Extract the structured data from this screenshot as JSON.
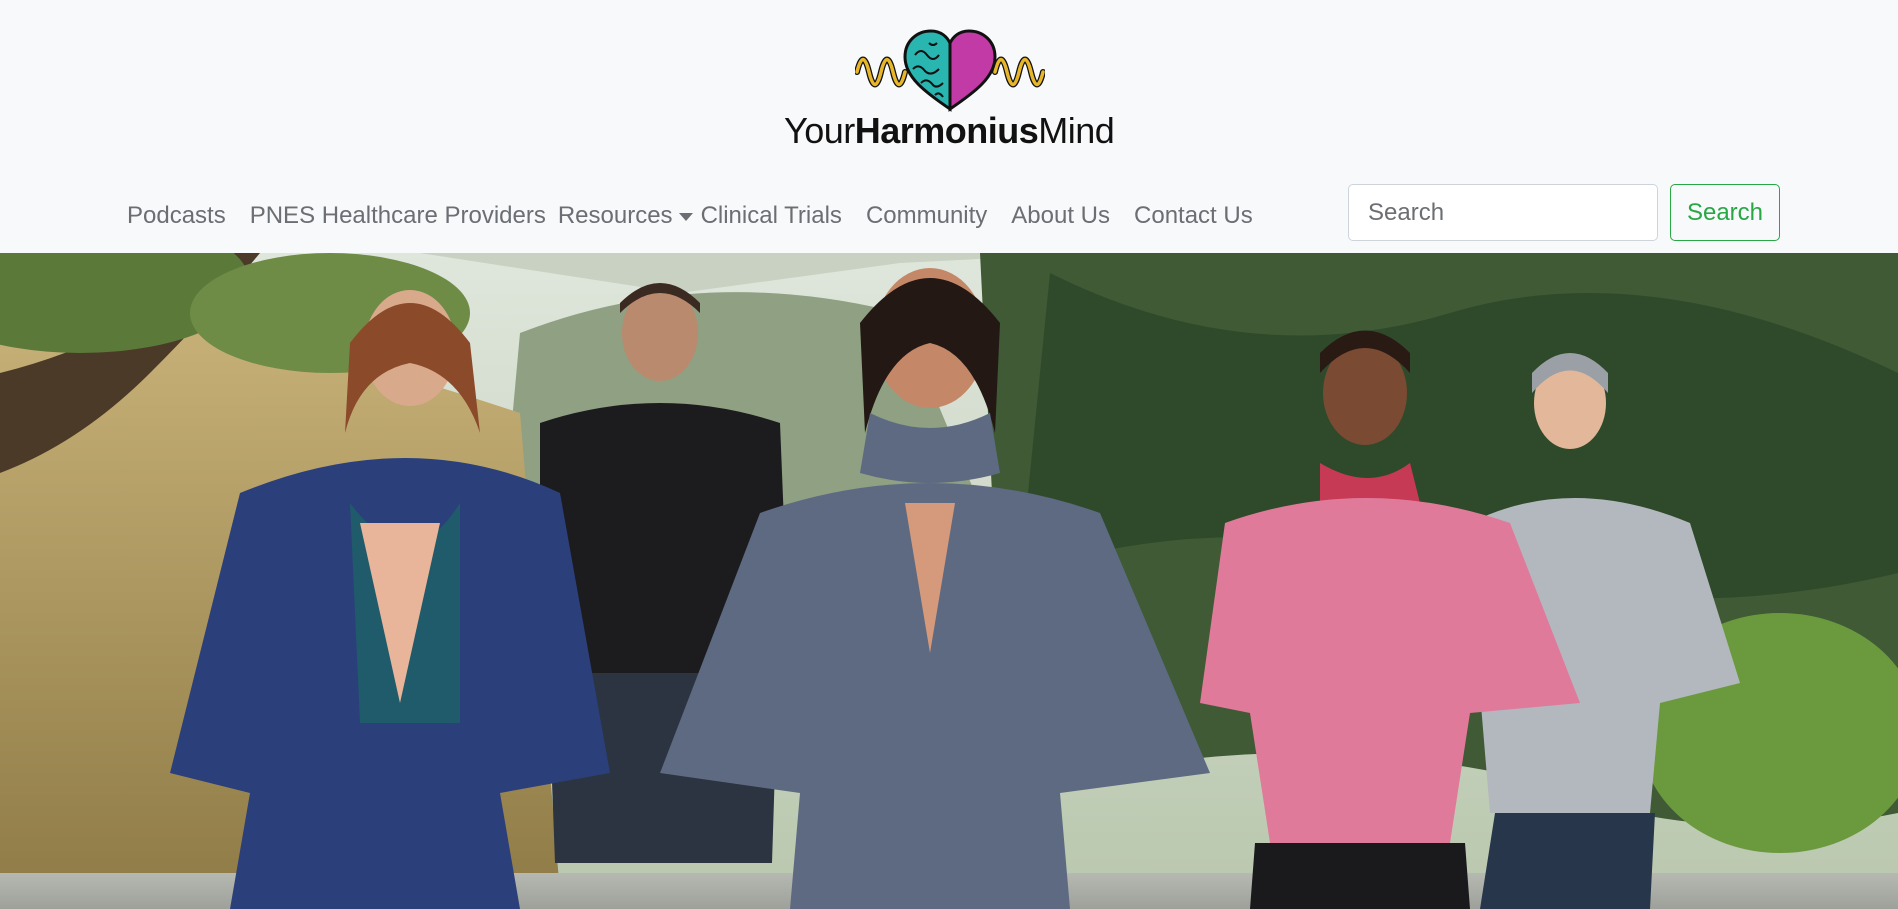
{
  "logo": {
    "wordmark_light": "Your",
    "wordmark_bold": "Harmonius",
    "wordmark_end": "Mind",
    "colors": {
      "wave": "#e8b62b",
      "brain": "#29b5b0",
      "heart": "#c23aa6",
      "outline": "#111111"
    }
  },
  "nav": {
    "items": [
      {
        "label": "Podcasts"
      },
      {
        "label": "PNES Healthcare Providers"
      },
      {
        "label": "Resources",
        "icon": "caret-down-icon"
      },
      {
        "label": "Clinical Trials"
      },
      {
        "label": "Community"
      },
      {
        "label": "About Us"
      },
      {
        "label": "Contact Us"
      }
    ]
  },
  "search": {
    "placeholder": "Search",
    "button_label": "Search",
    "accent": "#28a745"
  },
  "hero": {
    "image": "five-people-meditating-outdoors"
  }
}
